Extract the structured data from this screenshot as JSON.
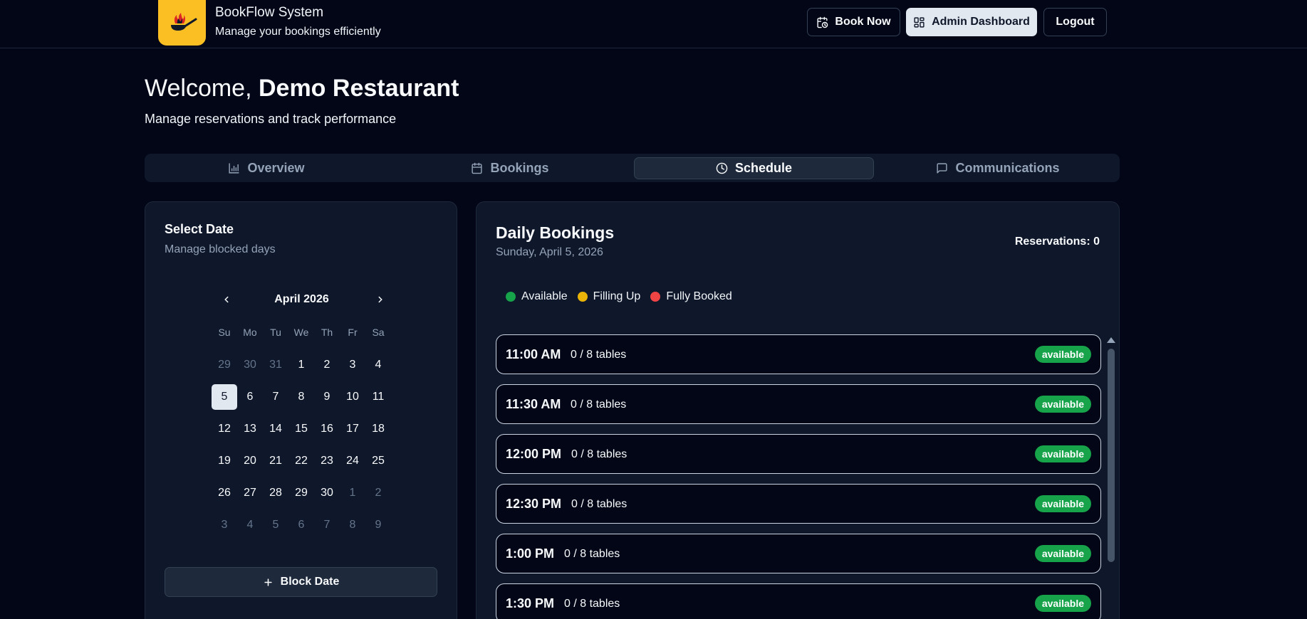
{
  "header": {
    "brand_title": "BookFlow System",
    "brand_subtitle": "Manage your bookings efficiently",
    "book_now": "Book Now",
    "admin_dashboard": "Admin Dashboard",
    "logout": "Logout"
  },
  "welcome": {
    "greeting": "Welcome, ",
    "name": "Demo Restaurant",
    "subtitle": "Manage reservations and track performance"
  },
  "tabs": {
    "overview": "Overview",
    "bookings": "Bookings",
    "schedule": "Schedule",
    "communications": "Communications",
    "active": "schedule"
  },
  "calendar": {
    "title": "Select Date",
    "subtitle": "Manage blocked days",
    "month": "April 2026",
    "weekdays": [
      "Su",
      "Mo",
      "Tu",
      "We",
      "Th",
      "Fr",
      "Sa"
    ],
    "days": [
      {
        "d": "29",
        "muted": true
      },
      {
        "d": "30",
        "muted": true
      },
      {
        "d": "31",
        "muted": true
      },
      {
        "d": "1"
      },
      {
        "d": "2"
      },
      {
        "d": "3"
      },
      {
        "d": "4"
      },
      {
        "d": "5",
        "selected": true
      },
      {
        "d": "6"
      },
      {
        "d": "7"
      },
      {
        "d": "8"
      },
      {
        "d": "9"
      },
      {
        "d": "10"
      },
      {
        "d": "11"
      },
      {
        "d": "12"
      },
      {
        "d": "13"
      },
      {
        "d": "14"
      },
      {
        "d": "15"
      },
      {
        "d": "16"
      },
      {
        "d": "17"
      },
      {
        "d": "18"
      },
      {
        "d": "19"
      },
      {
        "d": "20"
      },
      {
        "d": "21"
      },
      {
        "d": "22"
      },
      {
        "d": "23"
      },
      {
        "d": "24"
      },
      {
        "d": "25"
      },
      {
        "d": "26"
      },
      {
        "d": "27"
      },
      {
        "d": "28"
      },
      {
        "d": "29"
      },
      {
        "d": "30"
      },
      {
        "d": "1",
        "muted": true
      },
      {
        "d": "2",
        "muted": true
      },
      {
        "d": "3",
        "muted": true
      },
      {
        "d": "4",
        "muted": true
      },
      {
        "d": "5",
        "muted": true
      },
      {
        "d": "6",
        "muted": true
      },
      {
        "d": "7",
        "muted": true
      },
      {
        "d": "8",
        "muted": true
      },
      {
        "d": "9",
        "muted": true
      }
    ],
    "block_date": "Block Date"
  },
  "daily": {
    "title": "Daily Bookings",
    "date": "Sunday, April 5, 2026",
    "reservations": "Reservations: 0",
    "legend": [
      {
        "label": "Available",
        "color": "#16a34a"
      },
      {
        "label": "Filling Up",
        "color": "#eab308"
      },
      {
        "label": "Fully Booked",
        "color": "#ef4444"
      }
    ],
    "slots": [
      {
        "time": "11:00 AM",
        "capacity": "0 / 8 tables",
        "status": "available"
      },
      {
        "time": "11:30 AM",
        "capacity": "0 / 8 tables",
        "status": "available"
      },
      {
        "time": "12:00 PM",
        "capacity": "0 / 8 tables",
        "status": "available"
      },
      {
        "time": "12:30 PM",
        "capacity": "0 / 8 tables",
        "status": "available"
      },
      {
        "time": "1:00 PM",
        "capacity": "0 / 8 tables",
        "status": "available"
      },
      {
        "time": "1:30 PM",
        "capacity": "0 / 8 tables",
        "status": "available"
      }
    ]
  },
  "colors": {
    "background": "#020617",
    "card": "#0f172a",
    "brand": "#fbbf24",
    "available": "#16a34a"
  }
}
